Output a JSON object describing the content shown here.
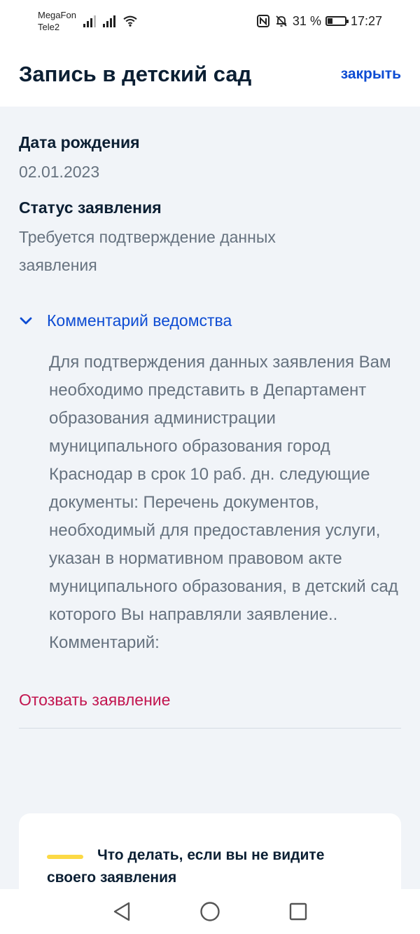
{
  "status_bar": {
    "carrier_1": "MegaFon",
    "carrier_2": "Tele2",
    "battery": "31 %",
    "battery_level": 0.31,
    "time": "17:27"
  },
  "header": {
    "title": "Запись в детский сад",
    "close_label": "закрыть"
  },
  "details": {
    "dob_label": "Дата рождения",
    "dob_value": "02.01.2023",
    "status_label": "Статус заявления",
    "status_value": "Требуется подтверждение данных заявления"
  },
  "comment": {
    "toggle_label": "Комментарий ведомства",
    "text": "Для подтверждения данных заявления Вам необходимо представить в Департамент образования администрации муниципального образования город Краснодар в срок 10 раб. дн. следующие документы: Перечень документов, необходимый для предоставления услуги, указан в нормативном правовом акте муниципального образования, в детский сад которого Вы направляли заявление.. Комментарий:"
  },
  "actions": {
    "revoke_label": "Отозвать заявление"
  },
  "info_card": {
    "title": "Что делать, если вы не видите своего заявления"
  },
  "colors": {
    "accent_blue": "#0d4cd3",
    "danger": "#c2154f",
    "muted_text": "#66727f",
    "card_accent": "#fcd945"
  }
}
